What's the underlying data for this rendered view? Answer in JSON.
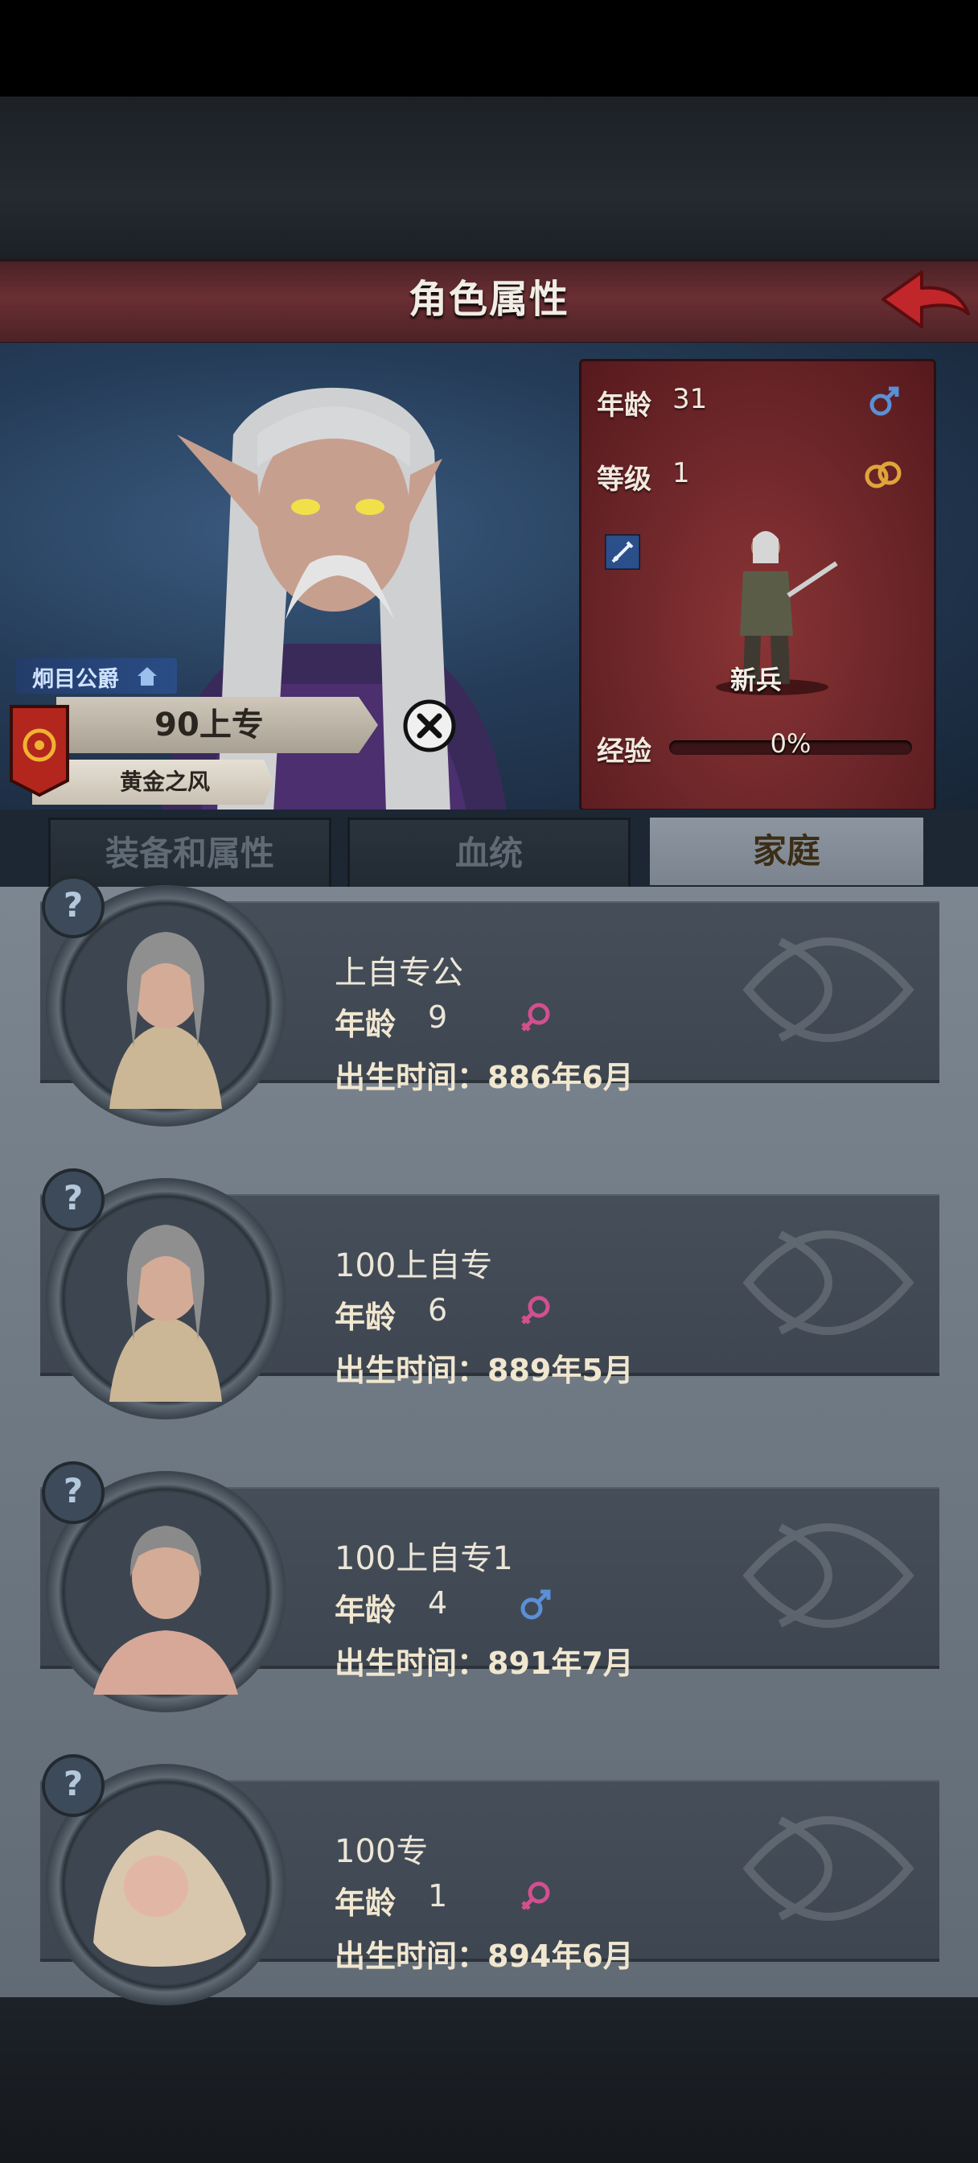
{
  "header": {
    "title": "角色属性"
  },
  "character": {
    "noble_title": "炯目公爵",
    "rank_name": "90上专",
    "house": "黄金之风"
  },
  "stats": {
    "age_label": "年龄",
    "age_value": "31",
    "sex": "male",
    "level_label": "等级",
    "level_value": "1",
    "marriage_icon": "rings-icon",
    "class_name": "新兵",
    "exp_label": "经验",
    "exp_value": "0%",
    "exp_fraction": 0
  },
  "tabs": [
    {
      "label": "装备和属性",
      "active": false
    },
    {
      "label": "血统",
      "active": false
    },
    {
      "label": "家庭",
      "active": true
    }
  ],
  "children": [
    {
      "name": "上自专公",
      "age_label": "年龄",
      "age": "9",
      "sex": "female",
      "birth_label": "出生时间：",
      "birth": "886年6月"
    },
    {
      "name": "100上自专",
      "age_label": "年龄",
      "age": "6",
      "sex": "female",
      "birth_label": "出生时间：",
      "birth": "889年5月"
    },
    {
      "name": "100上自专1",
      "age_label": "年龄",
      "age": "4",
      "sex": "male",
      "birth_label": "出生时间：",
      "birth": "891年7月"
    },
    {
      "name": "100专",
      "age_label": "年龄",
      "age": "1",
      "sex": "female",
      "birth_label": "出生时间：",
      "birth": "894年6月"
    }
  ],
  "colors": {
    "male": "#5b8fd6",
    "female": "#d2508f",
    "title_banner": "#6a2f33",
    "stats_panel": "#6c2629"
  }
}
